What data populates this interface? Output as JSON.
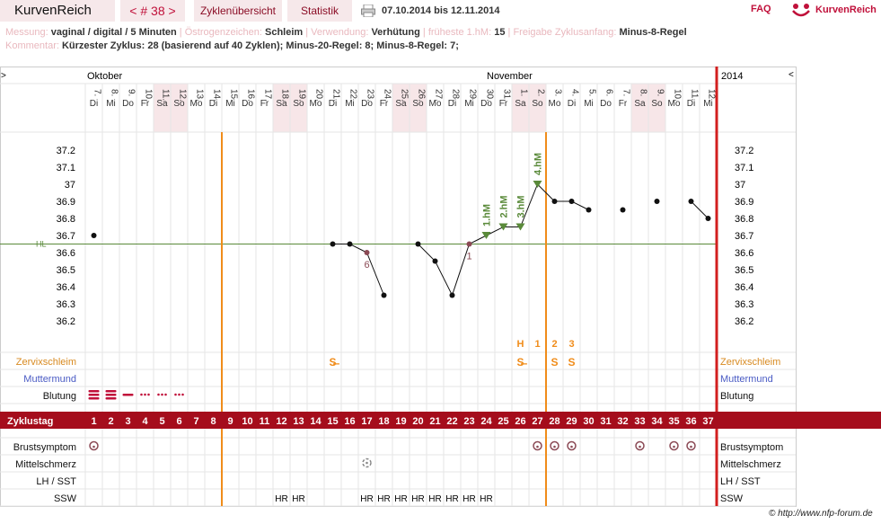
{
  "header": {
    "app_title": "KurvenReich",
    "cycle_label": "< # 38 >",
    "overview_tab": "Zyklenübersicht",
    "stats_tab": "Statistik",
    "date_range": "07.10.2014 bis 12.11.2014",
    "faq": "FAQ",
    "logo_text": "KurvenReich"
  },
  "info": {
    "messung_label": "Messung:",
    "messung_value": "vaginal / digital / 5 Minuten",
    "oestrogen_label": "Östrogenzeichen:",
    "oestrogen_value": "Schleim",
    "verwendung_label": "Verwendung:",
    "verwendung_value": "Verhütung",
    "fruehe_label": "früheste 1.hM:",
    "fruehe_value": "15",
    "freigabe_label": "Freigabe Zyklusanfang:",
    "freigabe_value": "Minus-8-Regel",
    "kommentar_label": "Kommentar:",
    "kommentar_value": "Kürzester Zyklus: 28 (basierend auf 40 Zyklen); Minus-20-Regel: 8; Minus-8-Regel: 7;"
  },
  "chart": {
    "month_oct": "Oktober",
    "month_nov": "November",
    "year": "2014",
    "nav_left": ">",
    "nav_right": "<",
    "hl_label": "HL",
    "days": [
      "7.",
      "8.",
      "9.",
      "10.",
      "11.",
      "12.",
      "13.",
      "14.",
      "15.",
      "16.",
      "17.",
      "18.",
      "19.",
      "20.",
      "21.",
      "22.",
      "23.",
      "24.",
      "25.",
      "26.",
      "27.",
      "28.",
      "29.",
      "30.",
      "31.",
      "1.",
      "2.",
      "3.",
      "4.",
      "5.",
      "6.",
      "7.",
      "8.",
      "9.",
      "10.",
      "11.",
      "12."
    ],
    "weekdays": [
      "Di",
      "Mi",
      "Do",
      "Fr",
      "Sa",
      "So",
      "Mo",
      "Di",
      "Mi",
      "Do",
      "Fr",
      "Sa",
      "So",
      "Mo",
      "Di",
      "Mi",
      "Do",
      "Fr",
      "Sa",
      "So",
      "Mo",
      "Di",
      "Mi",
      "Do",
      "Fr",
      "Sa",
      "So",
      "Mo",
      "Di",
      "Mi",
      "Do",
      "Fr",
      "Sa",
      "So",
      "Mo",
      "Di",
      "Mi"
    ],
    "weekend_cols": [
      4,
      5,
      11,
      12,
      18,
      19,
      25,
      26,
      32,
      33
    ],
    "y_ticks": [
      "37.2",
      "37.1",
      "37",
      "36.9",
      "36.8",
      "36.7",
      "36.6",
      "36.5",
      "36.4",
      "36.3",
      "36.2"
    ],
    "rows": {
      "zervix": "Zervixschleim",
      "muttermund": "Muttermund",
      "blutung": "Blutung",
      "zyklustag": "Zyklustag",
      "brust": "Brustsymptom",
      "mittel": "Mittelschmerz",
      "lh": "LH / SST",
      "ssw": "SSW"
    },
    "peak_marks": [
      "H",
      "1",
      "2",
      "3"
    ],
    "mucus_marks": [
      "S̶",
      "S̶",
      "S",
      "S"
    ],
    "point_labels": [
      "6",
      "1"
    ],
    "hm_labels": [
      "1.hM",
      "2.hM",
      "3.hM",
      "4.hM"
    ],
    "hr_mark": "HR",
    "cycle_days": [
      "1",
      "2",
      "3",
      "4",
      "5",
      "6",
      "7",
      "8",
      "9",
      "10",
      "11",
      "12",
      "13",
      "14",
      "15",
      "16",
      "17",
      "18",
      "19",
      "20",
      "21",
      "22",
      "23",
      "24",
      "25",
      "26",
      "27",
      "28",
      "29",
      "30",
      "31",
      "32",
      "33",
      "34",
      "35",
      "36",
      "37"
    ]
  },
  "chart_data": {
    "type": "line",
    "title": "",
    "ylabel": "",
    "ylim": [
      36.1,
      37.3
    ],
    "coverline": 36.65,
    "x": [
      "07.10",
      "08.10",
      "09.10",
      "10.10",
      "11.10",
      "12.10",
      "13.10",
      "14.10",
      "15.10",
      "16.10",
      "17.10",
      "18.10",
      "19.10",
      "20.10",
      "21.10",
      "22.10",
      "23.10",
      "24.10",
      "25.10",
      "26.10",
      "27.10",
      "28.10",
      "29.10",
      "30.10",
      "31.10",
      "01.11",
      "02.11",
      "03.11",
      "04.11",
      "05.11",
      "06.11",
      "07.11",
      "08.11",
      "09.11",
      "10.11",
      "11.11",
      "12.11"
    ],
    "values": [
      36.7,
      null,
      null,
      null,
      null,
      null,
      null,
      null,
      null,
      null,
      null,
      null,
      null,
      null,
      36.65,
      36.65,
      36.6,
      36.35,
      null,
      36.65,
      36.55,
      36.35,
      36.65,
      36.7,
      36.75,
      36.75,
      37.0,
      36.9,
      36.9,
      36.85,
      null,
      36.85,
      null,
      36.9,
      null,
      36.9,
      36.8
    ],
    "connected_segments": [
      [
        14,
        17
      ],
      [
        19,
        29
      ],
      [
        35,
        36
      ]
    ],
    "excluded_days": [
      16,
      22
    ],
    "high_measurements": [
      23,
      24,
      25,
      26
    ],
    "bleeding": [
      3,
      3,
      2,
      1,
      1,
      1,
      0
    ],
    "peak_day": 26,
    "ovulation_line_days": [
      7,
      26
    ],
    "brust_days": [
      0,
      26,
      27,
      28,
      32,
      34,
      35
    ],
    "mittel_days": [
      16
    ],
    "hr_days": [
      11,
      12,
      16,
      17,
      18,
      19,
      20,
      21,
      22,
      23
    ]
  },
  "colors": {
    "brand": "#c0103a",
    "band": "#a50d1c",
    "orange": "#f08c1a",
    "green": "#5a8a3a",
    "grid": "#e6e6e6",
    "weekend": "#f7e6e8",
    "red_line": "#d21f1f"
  }
}
